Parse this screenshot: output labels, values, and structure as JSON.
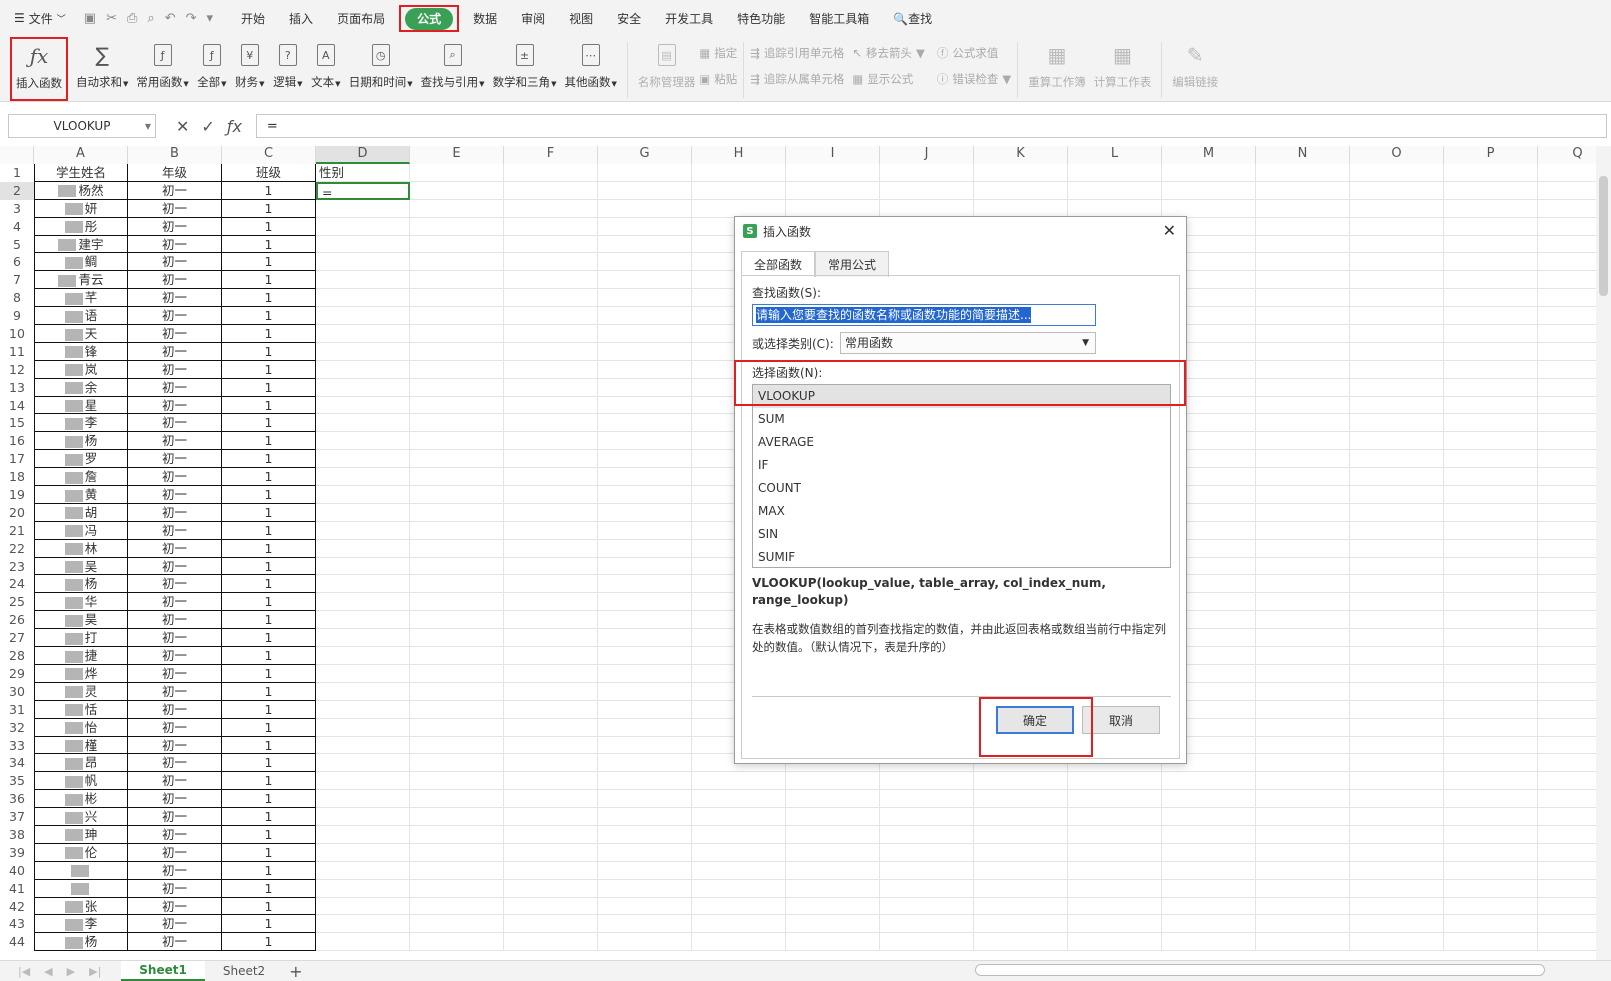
{
  "menubar": {
    "file_label": "文件",
    "tabs": [
      "开始",
      "插入",
      "页面布局",
      "公式",
      "数据",
      "审阅",
      "视图",
      "安全",
      "开发工具",
      "特色功能",
      "智能工具箱"
    ],
    "active_tab": "公式",
    "search_label": "查找"
  },
  "ribbon": {
    "insert_function": "插入函数",
    "autosum": "自动求和",
    "common_functions": "常用函数",
    "all": "全部",
    "finance": "财务",
    "logic": "逻辑",
    "text": "文本",
    "datetime": "日期和时间",
    "lookup": "查找与引用",
    "math": "数学和三角",
    "other": "其他函数",
    "name_manager": "名称管理器",
    "define": "指定",
    "paste": "粘贴",
    "trace_precedents": "追踪引用单元格",
    "trace_dependents": "追踪从属单元格",
    "remove_arrows": "移去箭头",
    "show_formulas": "显示公式",
    "evaluate": "公式求值",
    "error_check": "错误检查",
    "recalc_workbook": "重算工作簿",
    "calc_sheet": "计算工作表",
    "edit_links": "编辑链接"
  },
  "formula_bar": {
    "name_box": "VLOOKUP",
    "content": "="
  },
  "sheet": {
    "columns": [
      "A",
      "B",
      "C",
      "D",
      "E",
      "F",
      "G",
      "H",
      "I",
      "J",
      "K",
      "L",
      "M",
      "N",
      "O",
      "P",
      "Q"
    ],
    "headers": [
      "学生姓名",
      "年级",
      "班级",
      "性别"
    ],
    "active_cell_value": "=",
    "names": [
      "杨然",
      "妍",
      "彤",
      "建宇",
      "鲷",
      "青云",
      "芊",
      "语",
      "天",
      "锋",
      "岚",
      "余",
      "星",
      "李",
      "杨",
      "罗",
      "詹",
      "黄",
      "胡",
      "冯",
      "林",
      "吴",
      "杨",
      "华",
      "昊",
      "打",
      "捷",
      "烨",
      "灵",
      "恬",
      "怡",
      "槿",
      "昂",
      "帆",
      "彬",
      "兴",
      "珅",
      "伦",
      "",
      "",
      "张",
      "李",
      "杨"
    ],
    "grade": "初一",
    "class": "1",
    "row_count": 44
  },
  "sheet_tabs": [
    "Sheet1",
    "Sheet2"
  ],
  "dialog": {
    "title": "插入函数",
    "tabs": [
      "全部函数",
      "常用公式"
    ],
    "search_label": "查找函数(S):",
    "search_placeholder": "请输入您要查找的函数名称或函数功能的简要描述...",
    "category_label": "或选择类别(C):",
    "category_value": "常用函数",
    "select_label": "选择函数(N):",
    "functions": [
      "VLOOKUP",
      "SUM",
      "AVERAGE",
      "IF",
      "COUNT",
      "MAX",
      "SIN",
      "SUMIF"
    ],
    "selected_function": "VLOOKUP",
    "signature": "VLOOKUP(lookup_value, table_array, col_index_num, range_lookup)",
    "description": "在表格或数值数组的首列查找指定的数值，并由此返回表格或数组当前行中指定列处的数值。（默认情况下，表是升序的）",
    "ok_label": "确定",
    "cancel_label": "取消"
  }
}
